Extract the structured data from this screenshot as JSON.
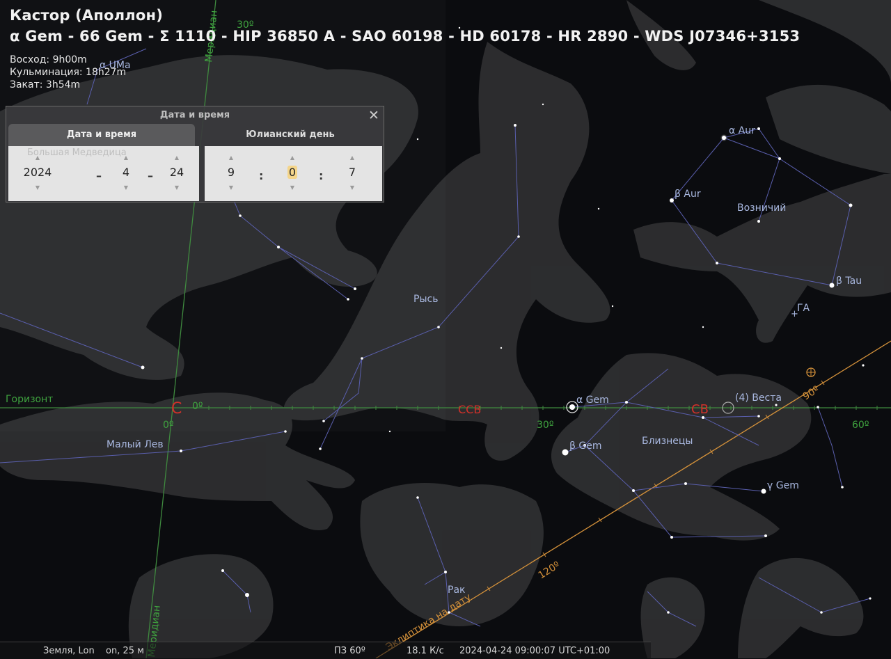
{
  "selected_object": {
    "title": "Кастор (Аполлон)",
    "identifiers": "α Gem - 66 Gem - Σ 1110 - HIP 36850 A - SAO 60198 - HD 60178 - HR 2890 - WDS J07346+3153",
    "rise": "Восход: 9h00m",
    "transit": "Кульминация: 18h27m",
    "set": "Закат: 3h54m"
  },
  "dialog": {
    "title": "Дата и время",
    "close_icon": "close-icon",
    "tabs": [
      "Дата и время",
      "Юлианский день"
    ],
    "ghost_label": "Большая Медведица",
    "date": {
      "year": "2024",
      "month": "4",
      "day": "24"
    },
    "time": {
      "hour": "9",
      "minute": "0",
      "second": "7"
    },
    "date_sep": "–",
    "time_sep": ":"
  },
  "labels": {
    "constellations": [
      "Рысь",
      "Возничий",
      "Малый Лев",
      "Близнецы",
      "Рак"
    ],
    "stars": [
      "α UMa",
      "α Aur",
      "β Aur",
      "β Tau",
      "α Gem",
      "β Gem",
      "γ Gem"
    ],
    "objects": [
      "ГА",
      "(4) Веста"
    ],
    "horizon": "Горизонт",
    "meridian": "Меридиан",
    "ecliptic": "Эклиптика на дату",
    "cardinals": [
      "С",
      "ССВ",
      "СВ"
    ],
    "azimuth_ticks": [
      "0º",
      "0º",
      "30º",
      "60º"
    ],
    "meridian_ticks": [
      "30º"
    ],
    "ecliptic_ticks": [
      "90º",
      "120º"
    ]
  },
  "status_bar": {
    "location": "Земля, Lon",
    "suffix": "on, 25 м",
    "fov": "ПЗ 60º",
    "fps": "18.1 К/с",
    "datetime": "2024-04-24 09:00:07 UTC+01:00"
  },
  "colors": {
    "background": "#0b0c0f",
    "constellation_lines": "#5a5fae",
    "horizon": "#3f8a3f",
    "ecliptic": "#d4913a",
    "cardinal": "#d2312a",
    "labels": "#a9b8e0"
  }
}
